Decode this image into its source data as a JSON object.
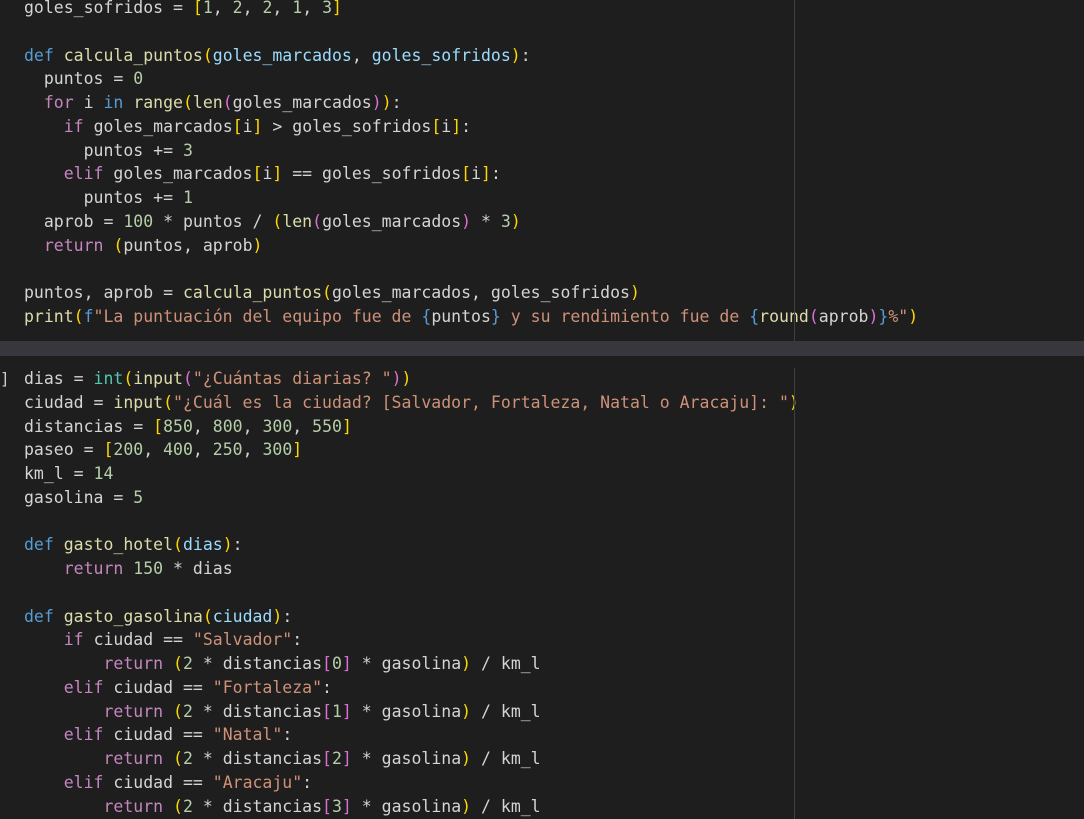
{
  "colors": {
    "editor_bg": "#1e1e1e",
    "separator": "#37373d",
    "keyword": "#569cd6",
    "control": "#c586c0",
    "function": "#dcdcaa",
    "builtin_type": "#4ec9b0",
    "parameter": "#9cdcfe",
    "number": "#b5cea8",
    "string": "#ce9178",
    "text": "#d4d4d4",
    "bracket_1": "#ffd700",
    "bracket_2": "#da70d6",
    "bracket_3": "#179fff"
  },
  "cell_1": {
    "lines": [
      [
        [
          "goles_sofridos = ",
          "txt"
        ],
        [
          "[",
          "p1"
        ],
        [
          "1",
          "num"
        ],
        [
          ", ",
          "txt"
        ],
        [
          "2",
          "num"
        ],
        [
          ", ",
          "txt"
        ],
        [
          "2",
          "num"
        ],
        [
          ", ",
          "txt"
        ],
        [
          "1",
          "num"
        ],
        [
          ", ",
          "txt"
        ],
        [
          "3",
          "num"
        ],
        [
          "]",
          "p1"
        ]
      ],
      [],
      [
        [
          "def ",
          "kw"
        ],
        [
          "calcula_puntos",
          "fn"
        ],
        [
          "(",
          "p1"
        ],
        [
          "goles_marcados",
          "var"
        ],
        [
          ", ",
          "txt"
        ],
        [
          "goles_sofridos",
          "var"
        ],
        [
          ")",
          "p1"
        ],
        [
          ":",
          "txt"
        ]
      ],
      [
        [
          "  puntos = ",
          "txt"
        ],
        [
          "0",
          "num"
        ]
      ],
      [
        [
          "  ",
          "txt"
        ],
        [
          "for ",
          "ct"
        ],
        [
          "i ",
          "txt"
        ],
        [
          "in ",
          "kw"
        ],
        [
          "range",
          "fn"
        ],
        [
          "(",
          "p1"
        ],
        [
          "len",
          "fn"
        ],
        [
          "(",
          "p2"
        ],
        [
          "goles_marcados",
          "txt"
        ],
        [
          ")",
          "p2"
        ],
        [
          ")",
          "p1"
        ],
        [
          ":",
          "txt"
        ]
      ],
      [
        [
          "    ",
          "txt"
        ],
        [
          "if ",
          "ct"
        ],
        [
          "goles_marcados",
          "txt"
        ],
        [
          "[",
          "p1"
        ],
        [
          "i",
          "txt"
        ],
        [
          "]",
          "p1"
        ],
        [
          " > goles_sofridos",
          "txt"
        ],
        [
          "[",
          "p1"
        ],
        [
          "i",
          "txt"
        ],
        [
          "]",
          "p1"
        ],
        [
          ":",
          "txt"
        ]
      ],
      [
        [
          "      puntos += ",
          "txt"
        ],
        [
          "3",
          "num"
        ]
      ],
      [
        [
          "    ",
          "txt"
        ],
        [
          "elif ",
          "ct"
        ],
        [
          "goles_marcados",
          "txt"
        ],
        [
          "[",
          "p1"
        ],
        [
          "i",
          "txt"
        ],
        [
          "]",
          "p1"
        ],
        [
          " == goles_sofridos",
          "txt"
        ],
        [
          "[",
          "p1"
        ],
        [
          "i",
          "txt"
        ],
        [
          "]",
          "p1"
        ],
        [
          ":",
          "txt"
        ]
      ],
      [
        [
          "      puntos += ",
          "txt"
        ],
        [
          "1",
          "num"
        ]
      ],
      [
        [
          "  aprob = ",
          "txt"
        ],
        [
          "100",
          "num"
        ],
        [
          " * puntos / ",
          "txt"
        ],
        [
          "(",
          "p1"
        ],
        [
          "len",
          "fn"
        ],
        [
          "(",
          "p2"
        ],
        [
          "goles_marcados",
          "txt"
        ],
        [
          ")",
          "p2"
        ],
        [
          " * ",
          "txt"
        ],
        [
          "3",
          "num"
        ],
        [
          ")",
          "p1"
        ]
      ],
      [
        [
          "  ",
          "txt"
        ],
        [
          "return ",
          "ct"
        ],
        [
          "(",
          "p1"
        ],
        [
          "puntos, aprob",
          "txt"
        ],
        [
          ")",
          "p1"
        ]
      ],
      [],
      [
        [
          "puntos, aprob = ",
          "txt"
        ],
        [
          "calcula_puntos",
          "fn"
        ],
        [
          "(",
          "p1"
        ],
        [
          "goles_marcados, goles_sofridos",
          "txt"
        ],
        [
          ")",
          "p1"
        ]
      ],
      [
        [
          "print",
          "fn"
        ],
        [
          "(",
          "p1"
        ],
        [
          "f",
          "kw"
        ],
        [
          "\"La puntuación del equipo fue de ",
          "str"
        ],
        [
          "{",
          "kw"
        ],
        [
          "puntos",
          "txt"
        ],
        [
          "}",
          "kw"
        ],
        [
          " y su rendimiento fue de ",
          "str"
        ],
        [
          "{",
          "kw"
        ],
        [
          "round",
          "fn"
        ],
        [
          "(",
          "p2"
        ],
        [
          "aprob",
          "txt"
        ],
        [
          ")",
          "p2"
        ],
        [
          "}",
          "kw"
        ],
        [
          "%\"",
          "str"
        ],
        [
          ")",
          "p1"
        ]
      ]
    ]
  },
  "cell_2": {
    "bracket_marker": "]",
    "lines": [
      [
        [
          "dias = ",
          "txt"
        ],
        [
          "int",
          "bi"
        ],
        [
          "(",
          "p1"
        ],
        [
          "input",
          "fn"
        ],
        [
          "(",
          "p2"
        ],
        [
          "\"¿Cuántas diarias? \"",
          "str"
        ],
        [
          ")",
          "p2"
        ],
        [
          ")",
          "p1"
        ]
      ],
      [
        [
          "ciudad = ",
          "txt"
        ],
        [
          "input",
          "fn"
        ],
        [
          "(",
          "p1"
        ],
        [
          "\"¿Cuál es la ciudad? [Salvador, Fortaleza, Natal o Aracaju]: \"",
          "str"
        ],
        [
          ")",
          "p1"
        ]
      ],
      [
        [
          "distancias = ",
          "txt"
        ],
        [
          "[",
          "p1"
        ],
        [
          "850",
          "num"
        ],
        [
          ", ",
          "txt"
        ],
        [
          "800",
          "num"
        ],
        [
          ", ",
          "txt"
        ],
        [
          "300",
          "num"
        ],
        [
          ", ",
          "txt"
        ],
        [
          "550",
          "num"
        ],
        [
          "]",
          "p1"
        ]
      ],
      [
        [
          "paseo = ",
          "txt"
        ],
        [
          "[",
          "p1"
        ],
        [
          "200",
          "num"
        ],
        [
          ", ",
          "txt"
        ],
        [
          "400",
          "num"
        ],
        [
          ", ",
          "txt"
        ],
        [
          "250",
          "num"
        ],
        [
          ", ",
          "txt"
        ],
        [
          "300",
          "num"
        ],
        [
          "]",
          "p1"
        ]
      ],
      [
        [
          "km_l = ",
          "txt"
        ],
        [
          "14",
          "num"
        ]
      ],
      [
        [
          "gasolina = ",
          "txt"
        ],
        [
          "5",
          "num"
        ]
      ],
      [],
      [
        [
          "def ",
          "kw"
        ],
        [
          "gasto_hotel",
          "fn"
        ],
        [
          "(",
          "p1"
        ],
        [
          "dias",
          "var"
        ],
        [
          ")",
          "p1"
        ],
        [
          ":",
          "txt"
        ]
      ],
      [
        [
          "    ",
          "txt"
        ],
        [
          "return ",
          "ct"
        ],
        [
          "150",
          "num"
        ],
        [
          " * dias",
          "txt"
        ]
      ],
      [],
      [
        [
          "def ",
          "kw"
        ],
        [
          "gasto_gasolina",
          "fn"
        ],
        [
          "(",
          "p1"
        ],
        [
          "ciudad",
          "var"
        ],
        [
          ")",
          "p1"
        ],
        [
          ":",
          "txt"
        ]
      ],
      [
        [
          "    ",
          "txt"
        ],
        [
          "if ",
          "ct"
        ],
        [
          "ciudad == ",
          "txt"
        ],
        [
          "\"Salvador\"",
          "str"
        ],
        [
          ":",
          "txt"
        ]
      ],
      [
        [
          "        ",
          "txt"
        ],
        [
          "return ",
          "ct"
        ],
        [
          "(",
          "p1"
        ],
        [
          "2",
          "num"
        ],
        [
          " * distancias",
          "txt"
        ],
        [
          "[",
          "p2"
        ],
        [
          "0",
          "num"
        ],
        [
          "]",
          "p2"
        ],
        [
          " * gasolina",
          "txt"
        ],
        [
          ")",
          "p1"
        ],
        [
          " / km_l",
          "txt"
        ]
      ],
      [
        [
          "    ",
          "txt"
        ],
        [
          "elif ",
          "ct"
        ],
        [
          "ciudad == ",
          "txt"
        ],
        [
          "\"Fortaleza\"",
          "str"
        ],
        [
          ":",
          "txt"
        ]
      ],
      [
        [
          "        ",
          "txt"
        ],
        [
          "return ",
          "ct"
        ],
        [
          "(",
          "p1"
        ],
        [
          "2",
          "num"
        ],
        [
          " * distancias",
          "txt"
        ],
        [
          "[",
          "p2"
        ],
        [
          "1",
          "num"
        ],
        [
          "]",
          "p2"
        ],
        [
          " * gasolina",
          "txt"
        ],
        [
          ")",
          "p1"
        ],
        [
          " / km_l",
          "txt"
        ]
      ],
      [
        [
          "    ",
          "txt"
        ],
        [
          "elif ",
          "ct"
        ],
        [
          "ciudad == ",
          "txt"
        ],
        [
          "\"Natal\"",
          "str"
        ],
        [
          ":",
          "txt"
        ]
      ],
      [
        [
          "        ",
          "txt"
        ],
        [
          "return ",
          "ct"
        ],
        [
          "(",
          "p1"
        ],
        [
          "2",
          "num"
        ],
        [
          " * distancias",
          "txt"
        ],
        [
          "[",
          "p2"
        ],
        [
          "2",
          "num"
        ],
        [
          "]",
          "p2"
        ],
        [
          " * gasolina",
          "txt"
        ],
        [
          ")",
          "p1"
        ],
        [
          " / km_l",
          "txt"
        ]
      ],
      [
        [
          "    ",
          "txt"
        ],
        [
          "elif ",
          "ct"
        ],
        [
          "ciudad == ",
          "txt"
        ],
        [
          "\"Aracaju\"",
          "str"
        ],
        [
          ":",
          "txt"
        ]
      ],
      [
        [
          "        ",
          "txt"
        ],
        [
          "return ",
          "ct"
        ],
        [
          "(",
          "p1"
        ],
        [
          "2",
          "num"
        ],
        [
          " * distancias",
          "txt"
        ],
        [
          "[",
          "p2"
        ],
        [
          "3",
          "num"
        ],
        [
          "]",
          "p2"
        ],
        [
          " * gasolina",
          "txt"
        ],
        [
          ")",
          "p1"
        ],
        [
          " / km_l",
          "txt"
        ]
      ]
    ]
  }
}
